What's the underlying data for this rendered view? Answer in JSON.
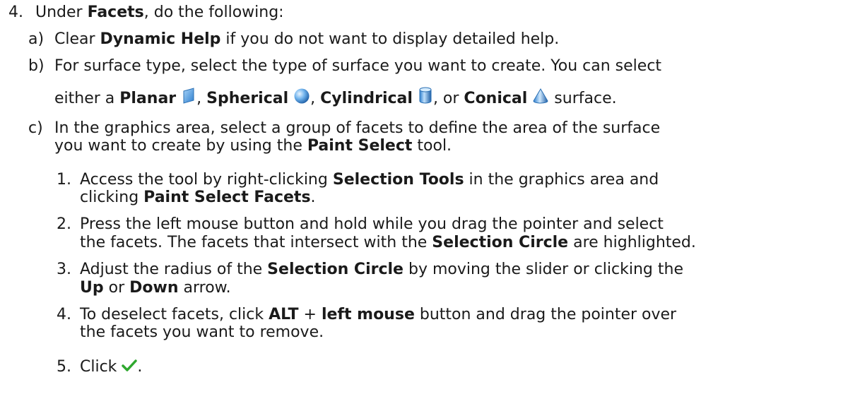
{
  "step4": {
    "num": "4.",
    "pre": "Under ",
    "facets": "Facets",
    "post": ", do the following:"
  },
  "a": {
    "num": "a)",
    "pre": "Clear ",
    "dynamic_help": "Dynamic Help",
    "post": " if you do not want to display detailed help."
  },
  "b": {
    "num": "b)",
    "line1": "For surface type, select the type of surface you want to create. You can select",
    "either": "either a ",
    "planar": "Planar",
    "sep1": ", ",
    "spherical": "Spherical",
    "sep2": ", ",
    "cylindrical": "Cylindrical",
    "sep3": ", or ",
    "conical": "Conical",
    "tail": " surface."
  },
  "c": {
    "num": "c)",
    "line1": "In the graphics area, select a group of facets to define the area of the surface",
    "line2_pre": "you want to create by using the ",
    "paint_select": "Paint Select",
    "line2_post": " tool."
  },
  "sub1": {
    "num": "1.",
    "pre": "Access the tool by right-clicking ",
    "selection_tools": "Selection Tools",
    "post": " in the graphics area and",
    "l2_pre": "clicking ",
    "paint_select_facets": "Paint Select Facets",
    "l2_post": "."
  },
  "sub2": {
    "num": "2.",
    "line1": "Press the left mouse button and hold while you drag the pointer and select",
    "l2_pre": "the facets. The facets that intersect with the ",
    "selection_circle": "Selection Circle",
    "l2_post": " are highlighted."
  },
  "sub3": {
    "num": "3.",
    "pre": "Adjust the radius of the ",
    "selection_circle": "Selection Circle",
    "post": " by moving the slider or clicking the",
    "up": "Up",
    "or": " or ",
    "down": "Down",
    "arrow": " arrow."
  },
  "sub4": {
    "num": "4.",
    "pre": "To deselect facets, click ",
    "alt": "ALT",
    "plus": " + ",
    "left_mouse": "left mouse",
    "post": " button and drag the pointer over",
    "line2": "the facets you want to remove."
  },
  "sub5": {
    "num": "5.",
    "click": "Click ",
    "period": "."
  },
  "icons": {
    "planar": "planar-surface-icon",
    "spherical": "spherical-surface-icon",
    "cylindrical": "cylindrical-surface-icon",
    "conical": "conical-surface-icon",
    "ok": "green-checkmark-icon"
  },
  "colors": {
    "text": "#1a1a1a",
    "icon_blue": "#3b8fd9",
    "check_green": "#2fa82f"
  }
}
